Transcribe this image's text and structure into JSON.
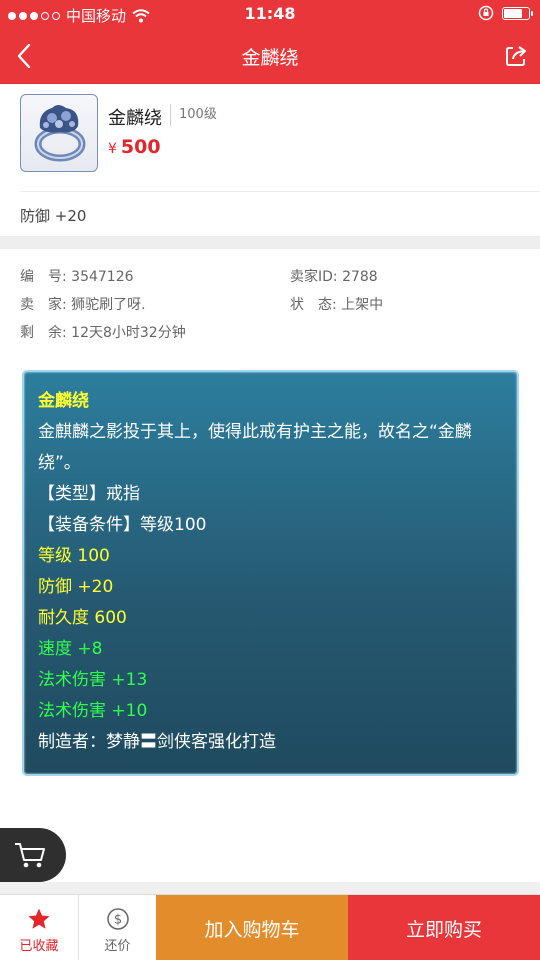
{
  "status_bar": {
    "carrier": "中国移动",
    "time": "11:48",
    "battery_level": 0.7
  },
  "navbar": {
    "title": "金麟绕",
    "back_icon": "chevron-left-icon",
    "share_icon": "share-icon"
  },
  "item": {
    "name": "金麟绕",
    "level": "100级",
    "currency": "¥",
    "price": "500",
    "stat": "防御 +20"
  },
  "info": {
    "id_label": "编　号: 3547126",
    "seller_id_label": "卖家ID: 2788",
    "seller_label": "卖　家: 狮驼刷了呀.",
    "status_label": "状　态: 上架中",
    "remaining_label": "剩　余: 12天8小时32分钟"
  },
  "description": {
    "title": "金麟绕",
    "text": "金麒麟之影投于其上，使得此戒有护主之能，故名之“金麟绕”。",
    "type_line": "【类型】戒指",
    "requirement_line": "【装备条件】等级100",
    "level_line": "等级 100",
    "defense_line": "防御 +20",
    "durability_line": "耐久度 600",
    "speed_line": "速度 +8",
    "magic1_line": "法术伤害 +13",
    "magic2_line": "法术伤害 +10",
    "maker_line": "制造者：梦静〓剑侠客强化打造"
  },
  "colors": {
    "brand_red": "#e8363a",
    "orange": "#e38c2c",
    "price_red": "#e2262c",
    "yellow_text": "#ffff2f",
    "green_text": "#2fff4a"
  },
  "bottom_bar": {
    "favorite_label": "已收藏",
    "bargain_label": "还价",
    "add_cart_label": "加入购物车",
    "buy_now_label": "立即购买"
  }
}
